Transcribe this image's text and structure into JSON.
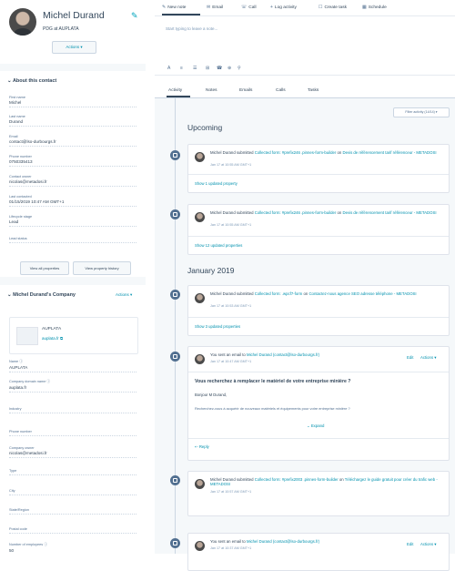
{
  "contact": {
    "name": "Michel Durand",
    "title": "PDG at AUPLATA",
    "actions_label": "Actions ▾"
  },
  "about": {
    "heading": "About this contact",
    "fields": [
      {
        "label": "First name",
        "value": "Michel"
      },
      {
        "label": "Last name",
        "value": "Durand"
      },
      {
        "label": "Email",
        "value": "contact@lso-durbourgs.fr"
      },
      {
        "label": "Phone number",
        "value": "0750335413"
      },
      {
        "label": "Contact owner",
        "value": "nicolas@metadosi.fr"
      },
      {
        "label": "Last contacted",
        "value": "01/15/2019 10:47 AM GMT+1"
      },
      {
        "label": "Lifecycle stage",
        "value": "Lead"
      },
      {
        "label": "Lead status",
        "value": ""
      }
    ],
    "view_all": "View all properties",
    "view_history": "View property history"
  },
  "company": {
    "heading": "Michel Durand's Company",
    "actions_label": "Actions ▾",
    "name": "AUPLATA",
    "url": "auplata.fr",
    "fields": [
      {
        "label": "Name",
        "value": "AUPLATA"
      },
      {
        "label": "Company domain name",
        "value": "auplata.fr"
      },
      {
        "label": "Industry",
        "value": ""
      },
      {
        "label": "Phone number",
        "value": ""
      },
      {
        "label": "Company owner",
        "value": "nicolas@metadosi.fr"
      },
      {
        "label": "Type",
        "value": ""
      },
      {
        "label": "City",
        "value": ""
      },
      {
        "label": "State/Region",
        "value": ""
      },
      {
        "label": "Postal code",
        "value": ""
      },
      {
        "label": "Number of employees",
        "value": "50"
      }
    ]
  },
  "toolbar": {
    "tabs": [
      "New note",
      "Email",
      "Call",
      "Log activity",
      "Create task",
      "Schedule"
    ],
    "icons": [
      "pencil-icon",
      "envelope-icon",
      "phone-icon",
      "plus-icon",
      "checkbox-icon",
      "calendar-icon"
    ]
  },
  "editor": {
    "placeholder": "Start typing to leave a note...",
    "format_icons": [
      "A",
      "≡",
      "☰",
      "⊞",
      "☎",
      "⊕",
      "🔗"
    ]
  },
  "activity_tabs": [
    "Activity",
    "Notes",
    "Emails",
    "Calls",
    "Tasks"
  ],
  "feed": {
    "filter_label": "Filter activity (14/14) ▾",
    "upcoming": "Upcoming",
    "january": "January 2019",
    "items": [
      {
        "prefix": "Michel Durand submitted ",
        "form": "Collected form: #prefix246 .pinnes-form-builder",
        "mid": " on ",
        "page": "Devis de référencement tarif référenceur - METADOSI",
        "time": "Jan 17 at 10:55 AM GMT+1",
        "more": "Show 1 updated property"
      },
      {
        "prefix": "Michel Durand submitted ",
        "form": "Collected form: #prefix246 .pinnes-form-builder",
        "mid": " on ",
        "page": "Devis de référencement tarif référenceur - METADOSI",
        "time": "Jan 17 at 10:55 AM GMT+1",
        "more": "Show 12 updated properties"
      },
      {
        "prefix": "Michel Durand submitted ",
        "form": "Collected form: .wpcf7-form",
        "mid": " on ",
        "page": "Contactez-nous agence SEO adresse téléphone - METADOSI",
        "time": "Jan 17 at 10:53 AM GMT+1",
        "more": "Show 3 updated properties"
      }
    ],
    "email": {
      "header_prefix": "You sent an email to ",
      "to": "Michel Durand (contact@lso-durbourgs.fr)",
      "time": "Jan 17 at 10:47 AM GMT+1",
      "edit": "Edit",
      "actions": "Actions ▾",
      "subject": "Vous recherchez à remplacer le matériel de votre entreprise minière ?",
      "greeting": "Bonjour M Durand,",
      "body": "Recherchez-vous à acquérir de nouveaux matériels et équipements pour votre entreprise minière ?",
      "expand": "Expand",
      "reply": "Reply"
    },
    "item4": {
      "prefix": "Michel Durand submitted ",
      "form": "Collected form: #prefix2003 .pinnes-form-builder",
      "mid": " on ",
      "page": "Téléchargez le guide gratuit pour créer du trafic web - METADOSI",
      "time": "Jan 17 at 10:57 AM GMT+1"
    },
    "email2": {
      "header_prefix": "You sent an email to ",
      "to": "Michel Durand (contact@lso-durbourgs.fr)",
      "time": "Jan 17 at 10:37 AM GMT+1",
      "edit": "Edit",
      "actions": "Actions ▾"
    }
  }
}
